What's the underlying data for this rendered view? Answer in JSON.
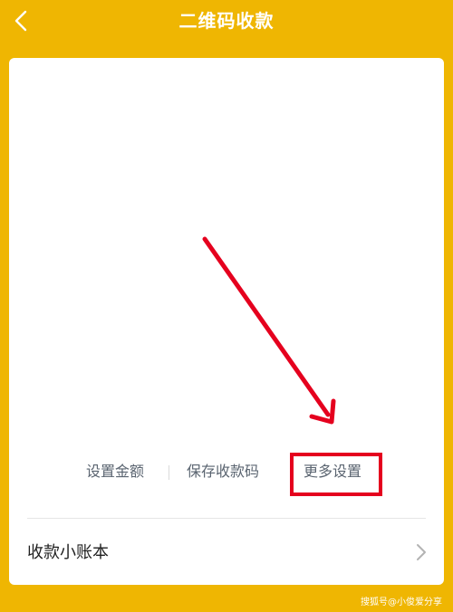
{
  "header": {
    "title": "二维码收款"
  },
  "actions": {
    "set_amount": "设置金额",
    "save_code": "保存收款码",
    "more_settings": "更多设置"
  },
  "ledger": {
    "label": "收款小账本"
  },
  "watermark": "搜狐号@小俊爱分享",
  "colors": {
    "background": "#EFB602",
    "annotation_red": "#E5001E",
    "link_text": "#5A6470"
  },
  "icons": {
    "back": "back-icon",
    "chevron": "chevron-right-icon"
  }
}
